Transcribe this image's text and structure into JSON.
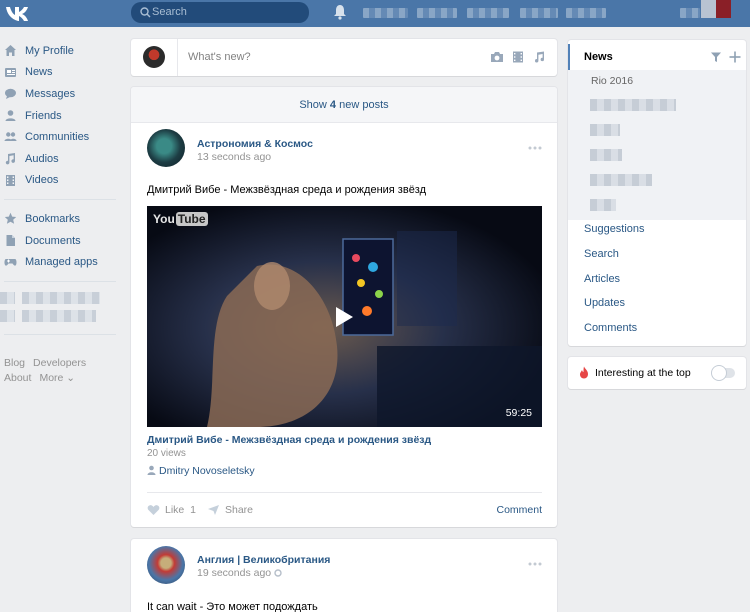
{
  "colors": {
    "topbar": "#4a76a8",
    "link": "#2a5885",
    "muted": "#939393",
    "background": "#edeef0"
  },
  "header": {
    "logo_icon": "vk-logo",
    "search_placeholder": "Search",
    "notifications_icon": "bell-icon"
  },
  "leftnav": {
    "items": [
      {
        "label": "My Profile",
        "icon": "home-icon"
      },
      {
        "label": "News",
        "icon": "news-icon"
      },
      {
        "label": "Messages",
        "icon": "message-icon"
      },
      {
        "label": "Friends",
        "icon": "user-icon"
      },
      {
        "label": "Communities",
        "icon": "users-icon"
      },
      {
        "label": "Audios",
        "icon": "music-icon"
      },
      {
        "label": "Videos",
        "icon": "film-icon"
      }
    ],
    "secondary": [
      {
        "label": "Bookmarks",
        "icon": "star-icon"
      },
      {
        "label": "Documents",
        "icon": "document-icon"
      },
      {
        "label": "Managed apps",
        "icon": "gamepad-icon"
      }
    ],
    "footer": {
      "blog": "Blog",
      "developers": "Developers",
      "about": "About",
      "more": "More ⌄"
    }
  },
  "composer": {
    "placeholder": "What's new?"
  },
  "feed": {
    "show_new_prefix": "Show ",
    "show_new_count": "4",
    "show_new_suffix": " new posts",
    "post1": {
      "author": "Астрономия & Космос",
      "time": "13 seconds ago",
      "text": "Дмитрий Вибе - Межзвёздная среда и рождения звёзд",
      "video": {
        "brand": "You",
        "brand_tube": "Tube",
        "duration": "59:25",
        "title": "Дмитрий Вибе - Межзвёздная среда и рождения звёзд",
        "views": "20 views",
        "uploader": "Dmitry Novoseletsky"
      },
      "like_label": "Like",
      "like_count": "1",
      "share_label": "Share",
      "comment_label": "Comment"
    },
    "post2": {
      "author": "Англия | Великобритания",
      "time": "19 seconds ago",
      "text": "It can wait - Это может подождать"
    }
  },
  "rightnav": {
    "active": "News",
    "sub_first": "Rio 2016",
    "links": [
      "Suggestions",
      "Search",
      "Articles",
      "Updates",
      "Comments"
    ]
  },
  "interesting": {
    "label": "Interesting at the top",
    "enabled": false
  }
}
